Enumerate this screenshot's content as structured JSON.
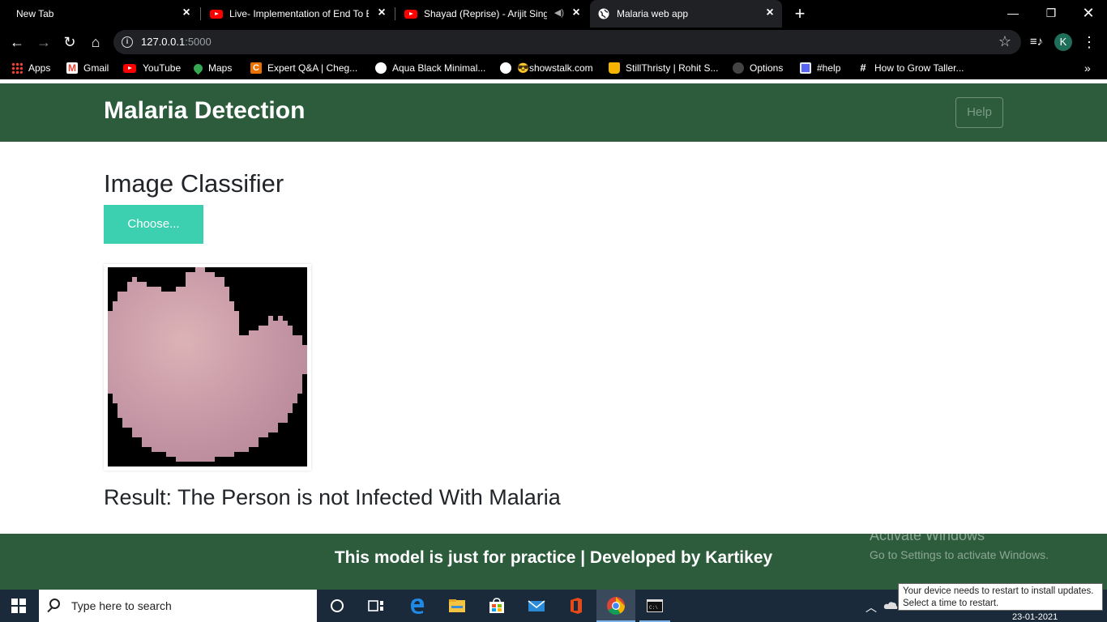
{
  "browser": {
    "tabs": [
      {
        "title": "New Tab",
        "active": false
      },
      {
        "title": "Live- Implementation of End To E",
        "active": false
      },
      {
        "title": "Shayad (Reprise) - Arijit Singh",
        "active": false
      },
      {
        "title": "Malaria web app",
        "active": true
      }
    ],
    "address": {
      "host": "127.0.0.1",
      "port": ":5000"
    },
    "profile_initial": "K",
    "bookmarks": [
      {
        "label": "Apps",
        "icon": "apps-grid-icon"
      },
      {
        "label": "Gmail",
        "icon": "gmail-icon"
      },
      {
        "label": "YouTube",
        "icon": "youtube-icon"
      },
      {
        "label": "Maps",
        "icon": "maps-icon"
      },
      {
        "label": "Expert Q&A | Cheg...",
        "icon": "chegg-icon"
      },
      {
        "label": "Aqua Black Minimal...",
        "icon": "globe-icon"
      },
      {
        "label": "😎showstalk.com",
        "icon": "globe-icon"
      },
      {
        "label": "StillThristy | Rohit S...",
        "icon": "mug-icon"
      },
      {
        "label": "Options",
        "icon": "github-icon"
      },
      {
        "label": "#help",
        "icon": "notification-icon"
      },
      {
        "label": "How to Grow Taller...",
        "icon": "hash-icon"
      }
    ]
  },
  "page": {
    "brand": "Malaria Detection",
    "help_label": "Help",
    "heading": "Image Classifier",
    "choose_label": "Choose...",
    "result": "Result: The Person is not Infected With Malaria",
    "footer": "This model is just for practice | Developed by Kartikey"
  },
  "windows": {
    "watermark_title": "Activate Windows",
    "watermark_sub": "Go to Settings to activate Windows.",
    "search_placeholder": "Type here to search",
    "toast_line1": "Your device needs to restart to install updates.",
    "toast_line2": "Select a time to restart.",
    "date": "23-01-2021"
  },
  "colors": {
    "navbar": "#2d5c3c",
    "choose_button": "#3ccfb0",
    "cell": "#c99aa8"
  }
}
